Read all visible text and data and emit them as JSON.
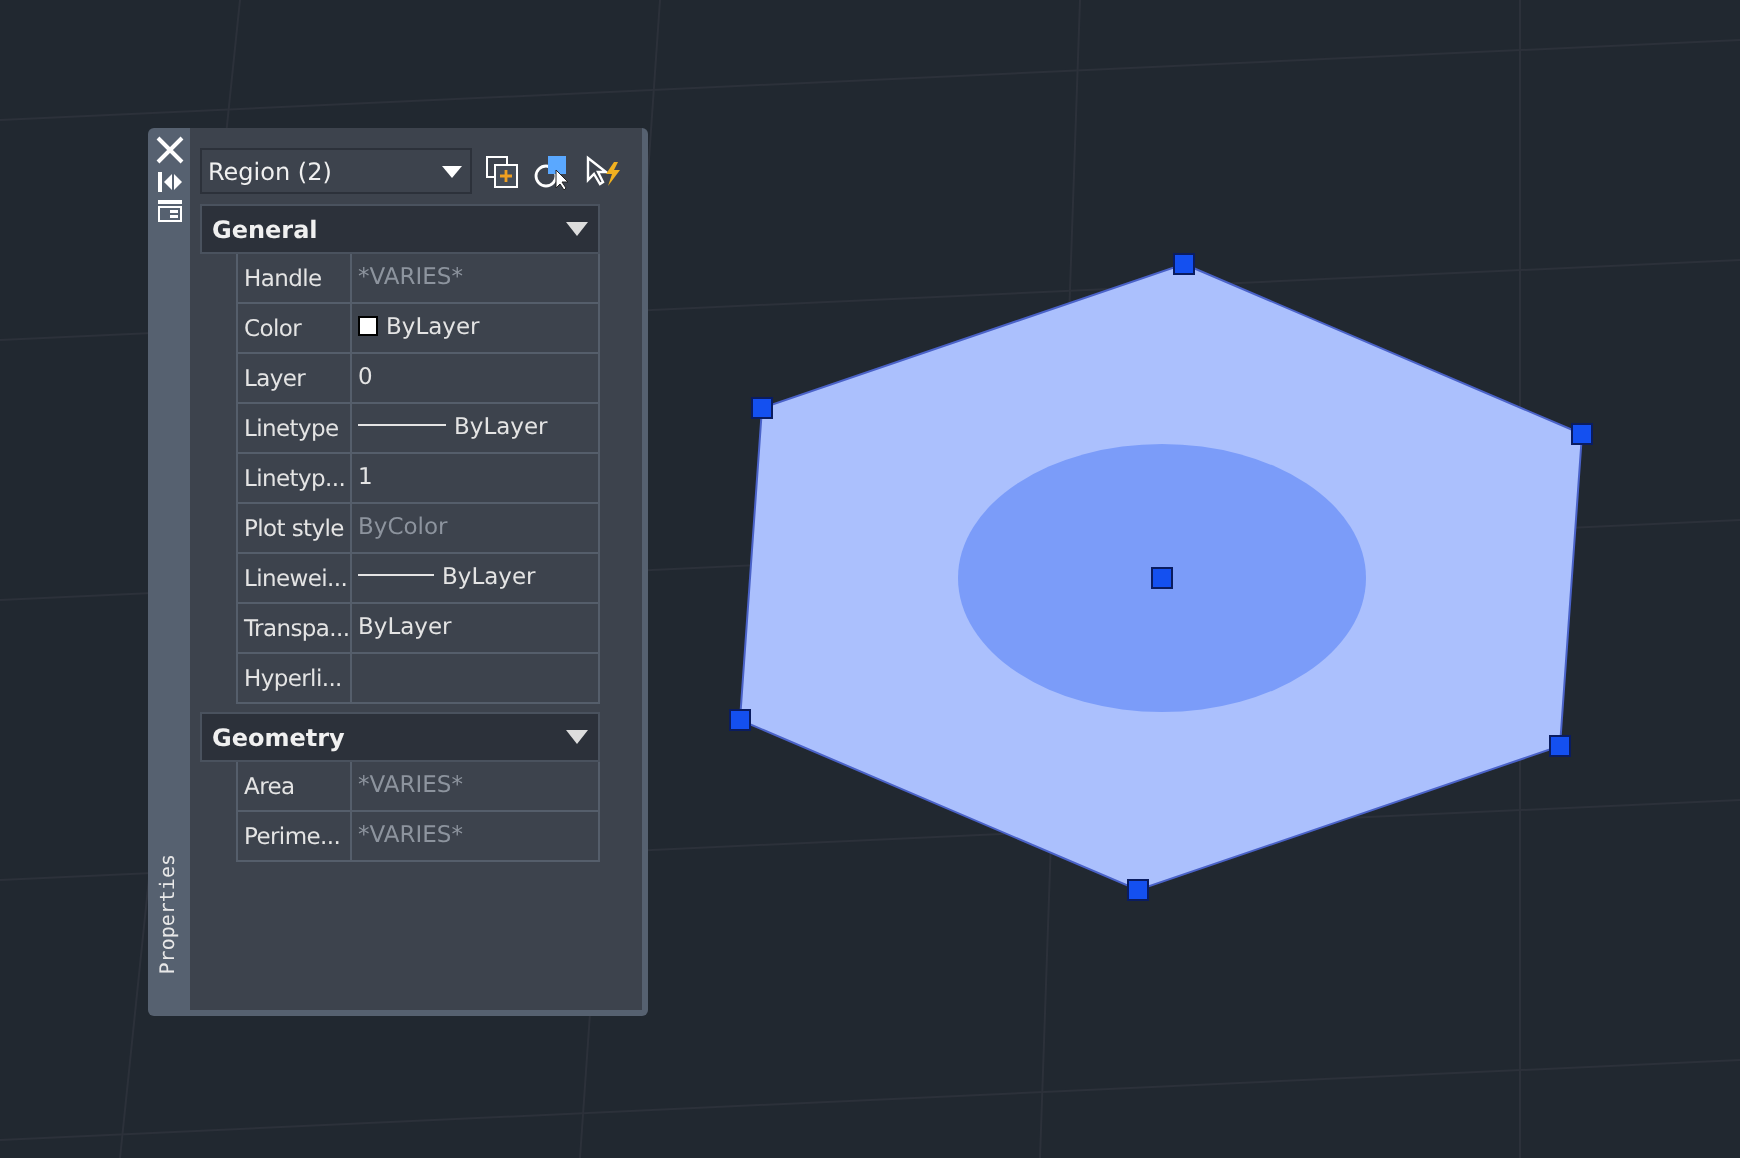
{
  "palette": {
    "title": "Properties",
    "selection": "Region (2)"
  },
  "sections": [
    {
      "title": "General",
      "expanded": true,
      "rows": [
        {
          "label": "Handle",
          "value": "*VARIES*",
          "kind": "plain",
          "greyed": true
        },
        {
          "label": "Color",
          "value": "ByLayer",
          "kind": "swatch",
          "greyed": false
        },
        {
          "label": "Layer",
          "value": "0",
          "kind": "plain",
          "greyed": false
        },
        {
          "label": "Linetype",
          "value": "ByLayer",
          "kind": "line",
          "greyed": false
        },
        {
          "label": "Linetyp...",
          "value": "1",
          "kind": "plain",
          "greyed": false
        },
        {
          "label": "Plot style",
          "value": "ByColor",
          "kind": "plain",
          "greyed": true
        },
        {
          "label": "Linewei...",
          "value": "ByLayer",
          "kind": "line",
          "greyed": false
        },
        {
          "label": "Transpa...",
          "value": "ByLayer",
          "kind": "plain",
          "greyed": false
        },
        {
          "label": "Hyperli...",
          "kind": "plain",
          "greyed": false
        }
      ]
    },
    {
      "title": "Geometry",
      "expanded": true,
      "rows": [
        {
          "label": "Area",
          "value": "*VARIES*",
          "kind": "plain",
          "greyed": true
        },
        {
          "label": "Perime...",
          "value": "*VARIES*",
          "kind": "plain",
          "greyed": true
        }
      ]
    }
  ]
}
